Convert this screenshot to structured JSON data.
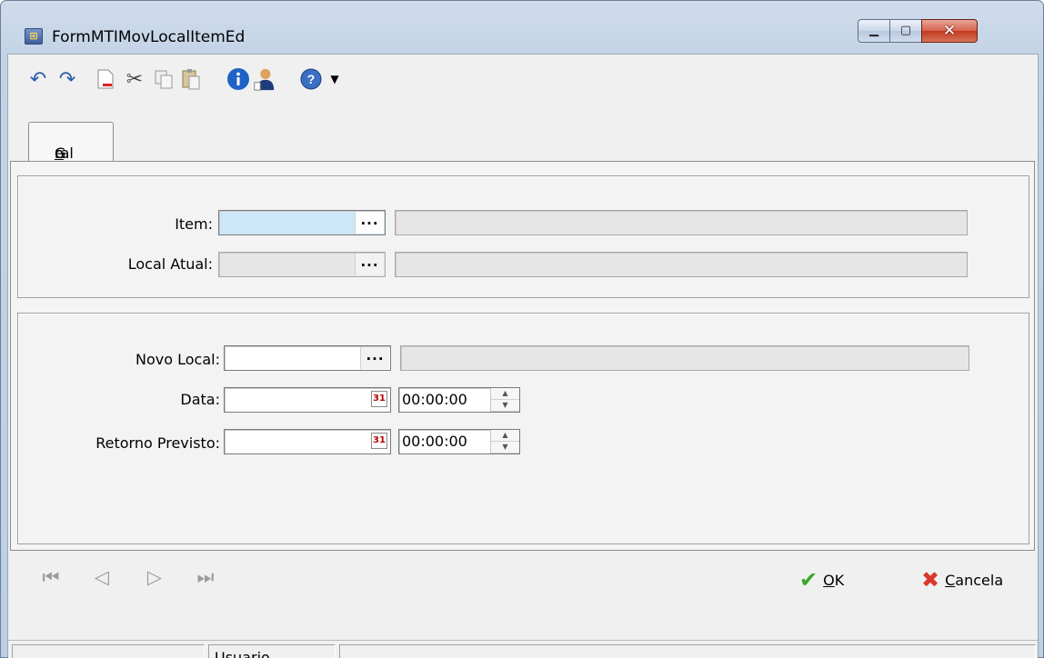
{
  "window": {
    "title": "FormMTIMovLocalItemEd"
  },
  "toolbar": {
    "icons": [
      "undo-icon",
      "redo-icon",
      "new-document-icon",
      "cut-icon",
      "copy-icon",
      "paste-icon",
      "info-icon",
      "user-icon",
      "help-icon",
      "dropdown-arrow-icon"
    ]
  },
  "tabs": [
    {
      "label_pre": "G",
      "label_u": "e",
      "label_post": "ral"
    }
  ],
  "form": {
    "item": {
      "label": "Item:",
      "value": "",
      "description": ""
    },
    "local_atual": {
      "label": "Local Atual:",
      "value": "",
      "description": ""
    },
    "novo_local": {
      "label": "Novo Local:",
      "value": "",
      "description": ""
    },
    "data": {
      "label": "Data:",
      "date": "",
      "time": "00:00:00"
    },
    "retorno": {
      "label": "Retorno Previsto:",
      "date": "",
      "time": "00:00:00"
    },
    "ellipsis": "...",
    "calendar_glyph": "31"
  },
  "buttons": {
    "ok": {
      "u": "O",
      "rest": "K"
    },
    "cancel": {
      "u": "C",
      "rest": "ancela"
    }
  },
  "statusbar": {
    "user": "Usuario"
  },
  "colors": {
    "focus": "#cce8f8",
    "ok_icon": "#39a82b",
    "cancel_icon": "#d83a2b"
  }
}
